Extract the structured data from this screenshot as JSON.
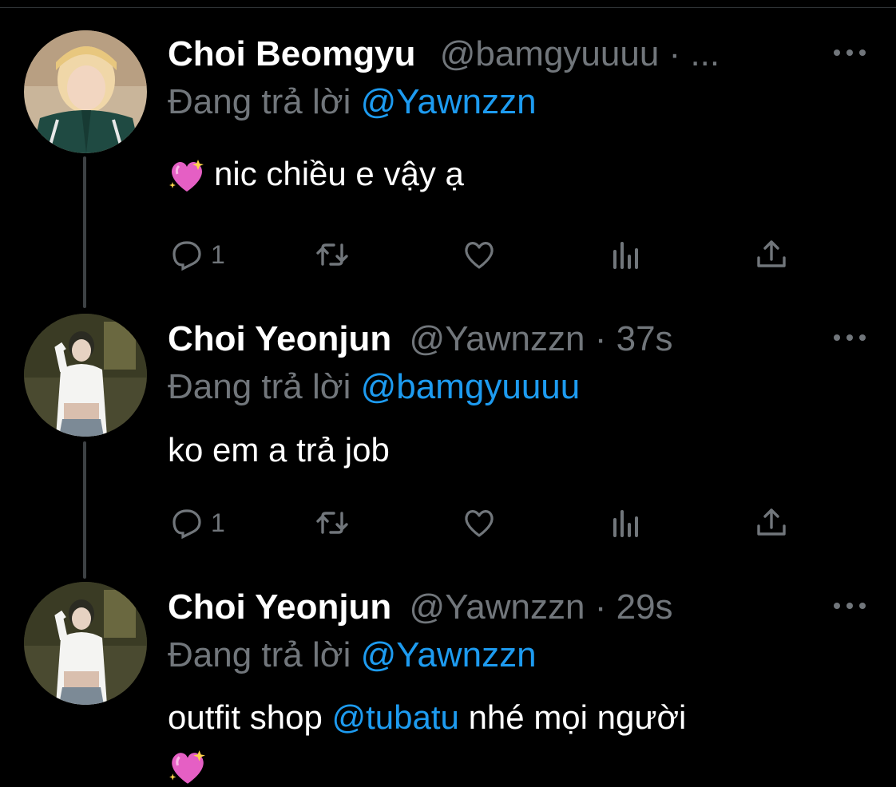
{
  "colors": {
    "background": "#000000",
    "accent": "#1d9bf0",
    "muted": "#71767b",
    "text": "#ffffff"
  },
  "tweets": [
    {
      "display_name": "Choi Beomgyu",
      "handle": "@bamgyuuuu",
      "separator": "·",
      "time": "...",
      "reply_label": "Đang trả lời",
      "reply_to": "@Yawnzzn",
      "text_prefix": "",
      "text": "nic chiều e vậy ạ",
      "text_mention": "",
      "text_suffix": "",
      "emoji": "sparkling-heart",
      "reply_count": "1",
      "avatar": "avatar-beomgyu"
    },
    {
      "display_name": "Choi Yeonjun",
      "handle": "@Yawnzzn",
      "separator": "·",
      "time": "37s",
      "reply_label": "Đang trả lời",
      "reply_to": "@bamgyuuuu",
      "text": "ko em a trả job",
      "reply_count": "1",
      "avatar": "avatar-yeonjun"
    },
    {
      "display_name": "Choi Yeonjun",
      "handle": "@Yawnzzn",
      "separator": "·",
      "time": "29s",
      "reply_label": "Đang trả lời",
      "reply_to": "@Yawnzzn",
      "text_prefix": "outfit shop",
      "text_mention": "@tubatu",
      "text_suffix": "nhé mọi người",
      "emoji": "sparkling-heart",
      "avatar": "avatar-yeonjun"
    }
  ],
  "icons": [
    "reply-icon",
    "retweet-icon",
    "like-icon",
    "views-icon",
    "share-icon",
    "more-icon"
  ]
}
